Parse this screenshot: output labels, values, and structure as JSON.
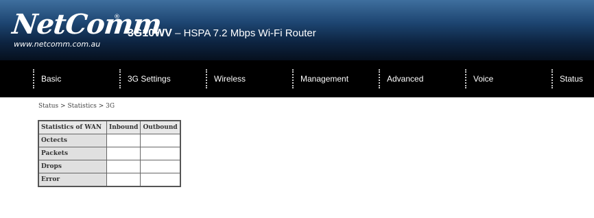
{
  "header": {
    "logo_text": "NetComm",
    "logo_reg": "®",
    "logo_url": "www.netcomm.com.au",
    "product_model": "3G10WV",
    "product_desc": " – HSPA 7.2 Mbps Wi-Fi Router"
  },
  "nav": {
    "items": [
      {
        "label": "Basic"
      },
      {
        "label": "3G Settings"
      },
      {
        "label": "Wireless"
      },
      {
        "label": "Management"
      },
      {
        "label": "Advanced"
      },
      {
        "label": "Voice"
      },
      {
        "label": "Status"
      }
    ]
  },
  "breadcrumb": "Status > Statistics > 3G",
  "stats_table": {
    "headers": [
      "Statistics of WAN",
      "Inbound",
      "Outbound"
    ],
    "rows": [
      {
        "label": "Octects",
        "inbound": "",
        "outbound": ""
      },
      {
        "label": "Packets",
        "inbound": "",
        "outbound": ""
      },
      {
        "label": "Drops",
        "inbound": "",
        "outbound": ""
      },
      {
        "label": "Error",
        "inbound": "",
        "outbound": ""
      }
    ]
  },
  "colors": {
    "nav_background": "#000000",
    "header_gradient_top": "#3f6f9e",
    "header_gradient_bottom": "#06101e"
  }
}
